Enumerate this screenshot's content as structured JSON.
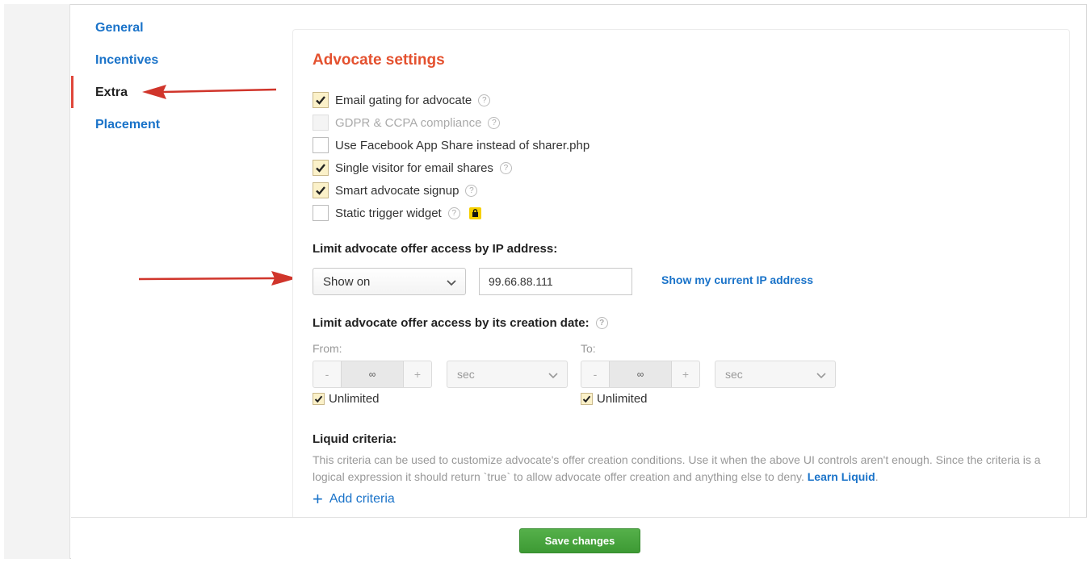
{
  "sidebar": {
    "items": [
      {
        "label": "General",
        "active": false
      },
      {
        "label": "Incentives",
        "active": false
      },
      {
        "label": "Extra",
        "active": true
      },
      {
        "label": "Placement",
        "active": false
      }
    ]
  },
  "advocate": {
    "title": "Advocate settings",
    "checkboxes": [
      {
        "label": "Email gating for advocate",
        "checked": true,
        "help": true
      },
      {
        "label": "GDPR & CCPA compliance",
        "checked": false,
        "disabled": true,
        "help": true
      },
      {
        "label": "Use Facebook App Share instead of sharer.php",
        "checked": false,
        "help": false
      },
      {
        "label": "Single visitor for email shares",
        "checked": true,
        "help": true
      },
      {
        "label": "Smart advocate signup",
        "checked": true,
        "help": true
      },
      {
        "label": "Static trigger widget",
        "checked": false,
        "help": true,
        "locked": true
      }
    ],
    "help_glyph": "?"
  },
  "ip_limit": {
    "heading": "Limit advocate offer access by IP address:",
    "mode": "Show on",
    "ip_value": "99.66.88.111",
    "show_ip_link": "Show my current IP address"
  },
  "date_limit": {
    "heading": "Limit advocate offer access by its creation date:",
    "from": {
      "label": "From:",
      "minus": "-",
      "value": "∞",
      "plus": "+",
      "unit": "sec",
      "unlimited_label": "Unlimited",
      "unlimited": true
    },
    "to": {
      "label": "To:",
      "minus": "-",
      "value": "∞",
      "plus": "+",
      "unit": "sec",
      "unlimited_label": "Unlimited",
      "unlimited": true
    }
  },
  "liquid": {
    "heading": "Liquid criteria:",
    "description": "This criteria can be used to customize advocate's offer creation conditions. Use it when the above UI controls aren't enough. Since the criteria is a logical expression it should return `true` to allow advocate offer creation and anything else to deny.",
    "learn_link": "Learn Liquid",
    "trailing": ".",
    "add_label": "Add criteria",
    "add_glyph": "+"
  },
  "footer": {
    "save_label": "Save changes"
  },
  "colors": {
    "accent_title": "#e4512f",
    "link": "#1a73c9",
    "save_green": "#3d9a34",
    "annotation_arrow": "#d0352b"
  }
}
